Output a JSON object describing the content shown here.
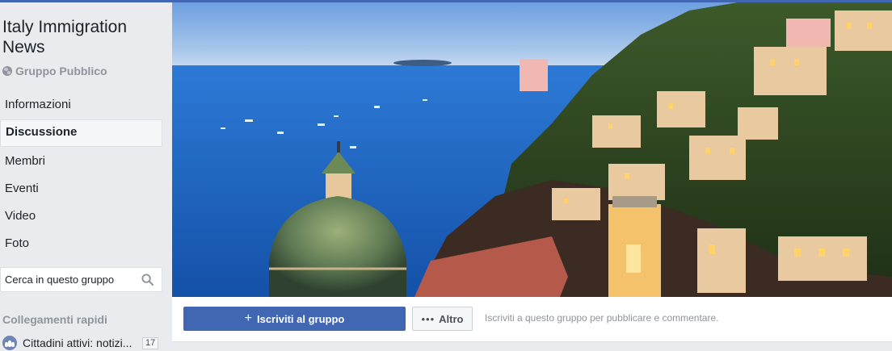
{
  "colors": {
    "brand": "#4267b2",
    "page_bg": "#e9ebee",
    "muted": "#90949c"
  },
  "group": {
    "name": "Italy Immigration News",
    "privacy": "Gruppo Pubblico",
    "privacy_icon": "globe-icon"
  },
  "sidebar": {
    "items": [
      {
        "label": "Informazioni",
        "active": false
      },
      {
        "label": "Discussione",
        "active": true
      },
      {
        "label": "Membri",
        "active": false
      },
      {
        "label": "Eventi",
        "active": false
      },
      {
        "label": "Video",
        "active": false
      },
      {
        "label": "Foto",
        "active": false
      }
    ],
    "search": {
      "placeholder": "Cerca in questo gruppo",
      "icon": "search-icon"
    },
    "quick_links": {
      "title": "Collegamenti rapidi",
      "items": [
        {
          "label": "Cittadini attivi: notizi...",
          "count": "17",
          "icon": "group-icon"
        }
      ]
    }
  },
  "cover": {
    "description_icon": "cover-photo"
  },
  "actions": {
    "join_label": "Iscriviti al gruppo",
    "join_icon": "plus-icon",
    "more_label": "Altro",
    "more_icon": "ellipsis-icon",
    "hint": "Iscriviti a questo gruppo per pubblicare e commentare."
  }
}
